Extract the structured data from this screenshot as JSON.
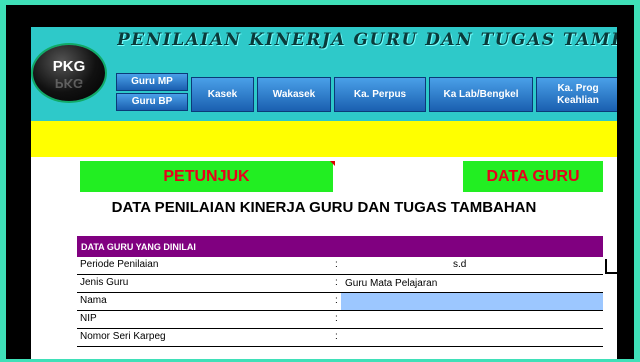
{
  "title": "PENILAIAN KINERJA GURU DAN TUGAS TAMBAHAN",
  "logo": {
    "text": "PKG"
  },
  "nav": {
    "guru_mp": "Guru MP",
    "guru_bp": "Guru BP",
    "kasek": "Kasek",
    "wakasek": "Wakasek",
    "ka_perpus": "Ka. Perpus",
    "ka_lab": "Ka Lab/Bengkel",
    "ka_prog": "Ka. Prog Keahlian"
  },
  "tabs": {
    "petunjuk": "PETUNJUK",
    "data_guru": "DATA GURU"
  },
  "heading": "DATA PENILAIAN KINERJA GURU DAN TUGAS TAMBAHAN",
  "table": {
    "header": "DATA GURU YANG DINILAI",
    "rows": [
      {
        "label": "Periode Penilaian",
        "colon": ":",
        "value": "",
        "extra": "s.d"
      },
      {
        "label": "Jenis Guru",
        "colon": ":",
        "value": "Guru Mata Pelajaran",
        "extra": ""
      },
      {
        "label": "Nama",
        "colon": ":",
        "value": "",
        "extra": ""
      },
      {
        "label": "NIP",
        "colon": ":",
        "value": "",
        "extra": ""
      },
      {
        "label": "Nomor Seri Karpeg",
        "colon": ":",
        "value": "",
        "extra": ""
      }
    ]
  },
  "colors": {
    "header_bg": "#2ec9c9",
    "yellow": "#ffff00",
    "green": "#22ee22",
    "red_text": "#e8001c",
    "purple": "#800080",
    "blue_cell": "#9cc7ff"
  }
}
